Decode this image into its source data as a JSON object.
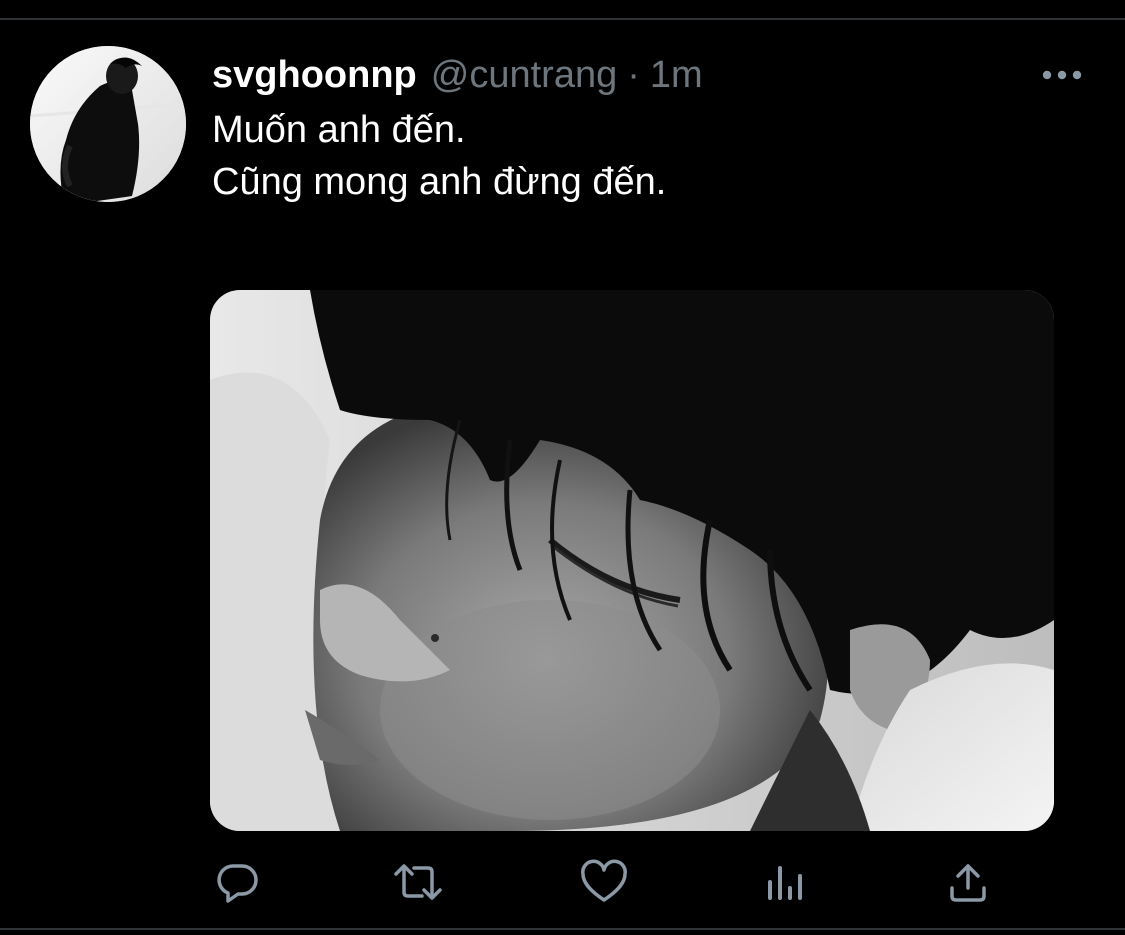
{
  "tweet": {
    "display_name": "svghoonnp",
    "handle": "@cuntrang",
    "separator": "·",
    "time": "1m",
    "text_lines": [
      "Muốn anh đến.",
      "Cũng mong anh đừng đến."
    ]
  },
  "icons": {
    "more": "more-horizontal-icon",
    "reply": "reply-bubble-icon",
    "retweet": "retweet-icon",
    "like": "heart-icon",
    "analytics": "bar-chart-icon",
    "share": "share-upload-icon"
  },
  "colors": {
    "background": "#000000",
    "primary_text": "#ffffff",
    "secondary_text": "#6e767d",
    "action_icon": "#8b98a5",
    "divider": "#2f3336"
  }
}
